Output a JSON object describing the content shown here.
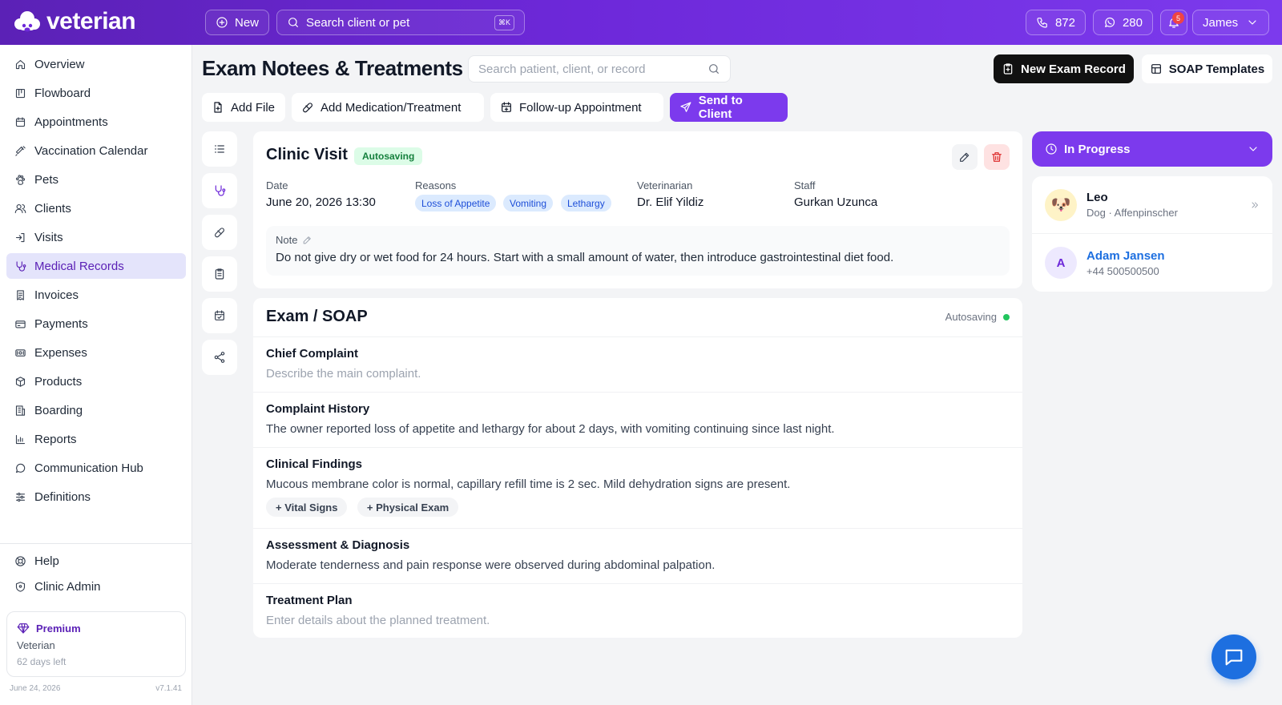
{
  "app": {
    "name": "veterian"
  },
  "topbar": {
    "new_label": "New",
    "search_placeholder": "Search client or pet",
    "search_shortcut": "⌘K",
    "calls_count": "872",
    "messages_count": "280",
    "notifications_count": "5",
    "user_name": "James"
  },
  "sidebar": {
    "items": [
      {
        "label": "Overview",
        "icon": "home-icon"
      },
      {
        "label": "Flowboard",
        "icon": "kanban-icon"
      },
      {
        "label": "Appointments",
        "icon": "calendar-icon"
      },
      {
        "label": "Vaccination Calendar",
        "icon": "syringe-icon"
      },
      {
        "label": "Pets",
        "icon": "paw-icon"
      },
      {
        "label": "Clients",
        "icon": "users-icon"
      },
      {
        "label": "Visits",
        "icon": "walk-in-icon"
      },
      {
        "label": "Medical Records",
        "icon": "stethoscope-icon",
        "active": true
      },
      {
        "label": "Invoices",
        "icon": "invoice-icon"
      },
      {
        "label": "Payments",
        "icon": "credit-card-icon"
      },
      {
        "label": "Expenses",
        "icon": "expense-icon"
      },
      {
        "label": "Products",
        "icon": "box-icon"
      },
      {
        "label": "Boarding",
        "icon": "building-icon"
      },
      {
        "label": "Reports",
        "icon": "chart-icon"
      },
      {
        "label": "Communication Hub",
        "icon": "chat-icon"
      },
      {
        "label": "Definitions",
        "icon": "list-settings-icon"
      }
    ],
    "bottom": [
      {
        "label": "Help",
        "icon": "lifebuoy-icon"
      },
      {
        "label": "Clinic Admin",
        "icon": "shield-icon"
      }
    ],
    "premium": {
      "title": "Premium",
      "plan": "Veterian",
      "days_left": "62 days left"
    },
    "footer_date": "June 24, 2026",
    "version": "v7.1.41"
  },
  "header": {
    "title": "Exam Notees & Treatments",
    "search_placeholder": "Search patient, client, or record",
    "new_exam_label": "New Exam Record",
    "soap_templates_label": "SOAP Templates"
  },
  "actions": {
    "add_file": "Add File",
    "add_medication": "Add Medication/Treatment",
    "follow_up": "Follow-up Appointment",
    "send_to_client": "Send to Client"
  },
  "clinic_visit": {
    "title": "Clinic Visit",
    "status": "Autosaving",
    "date_label": "Date",
    "date_value": "June 20, 2026 13:30",
    "reasons_label": "Reasons",
    "reasons": [
      "Loss of Appetite",
      "Vomiting",
      "Lethargy"
    ],
    "vet_label": "Veterinarian",
    "vet_value": "Dr. Elif Yildiz",
    "staff_label": "Staff",
    "staff_value": "Gurkan Uzunca",
    "note_label": "Note",
    "note_text": "Do not give dry or wet food for 24 hours. Start with a small amount of water, then introduce gastrointestinal diet food."
  },
  "soap": {
    "title": "Exam / SOAP",
    "status": "Autosaving",
    "sections": [
      {
        "heading": "Chief Complaint",
        "text": "Describe the main complaint.",
        "placeholder": true
      },
      {
        "heading": "Complaint History",
        "text": "The owner reported loss of appetite and lethargy for about 2 days, with vomiting continuing since last night."
      },
      {
        "heading": "Clinical Findings",
        "text": "Mucous membrane color is normal, capillary refill time is 2 sec. Mild dehydration signs are present.",
        "chips": [
          "+ Vital Signs",
          "+ Physical Exam"
        ]
      },
      {
        "heading": "Assessment & Diagnosis",
        "text": "Moderate tenderness and pain response were observed during abdominal palpation."
      },
      {
        "heading": "Treatment Plan",
        "text": "Enter details about the planned treatment.",
        "placeholder": true
      }
    ]
  },
  "right_panel": {
    "status": "In Progress",
    "pet": {
      "name": "Leo",
      "details": "Dog · Affenpinscher",
      "avatar": "🐶"
    },
    "client": {
      "name": "Adam Jansen",
      "phone": "+44 500500500",
      "initial": "A"
    }
  },
  "colors": {
    "brand": "#6d28d9",
    "accent": "#7c3aed",
    "success": "#22c55e",
    "link": "#1d4ed8"
  }
}
